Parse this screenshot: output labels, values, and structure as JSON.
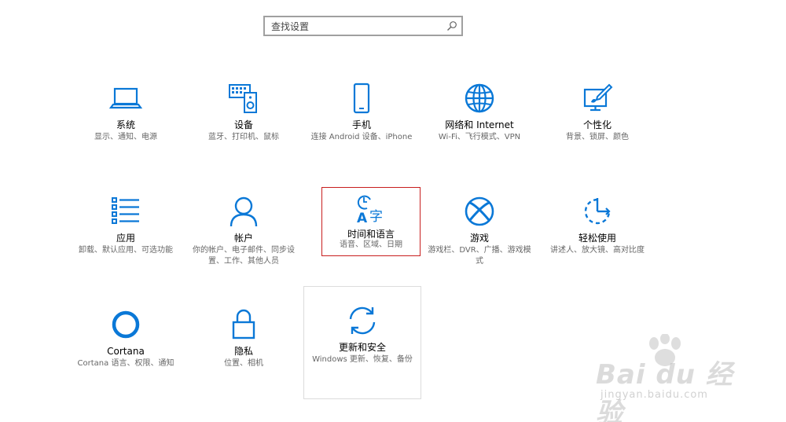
{
  "search": {
    "placeholder": "查找设置"
  },
  "tiles": [
    {
      "title": "系统",
      "desc": "显示、通知、电源"
    },
    {
      "title": "设备",
      "desc": "蓝牙、打印机、鼠标"
    },
    {
      "title": "手机",
      "desc": "连接 Android 设备、iPhone"
    },
    {
      "title": "网络和 Internet",
      "desc": "Wi-Fi、飞行模式、VPN"
    },
    {
      "title": "个性化",
      "desc": "背景、锁屏、颜色"
    },
    {
      "title": "应用",
      "desc": "卸载、默认应用、可选功能"
    },
    {
      "title": "帐户",
      "desc": "你的帐户、电子邮件、同步设置、工作、其他人员"
    },
    {
      "title": "时间和语言",
      "desc": "语音、区域、日期"
    },
    {
      "title": "游戏",
      "desc": "游戏栏、DVR、广播、游戏模式"
    },
    {
      "title": "轻松使用",
      "desc": "讲述人、放大镜、高对比度"
    },
    {
      "title": "Cortana",
      "desc": "Cortana 语言、权限、通知"
    },
    {
      "title": "隐私",
      "desc": "位置、相机"
    },
    {
      "title": "更新和安全",
      "desc": "Windows 更新、恢复、备份"
    }
  ],
  "colors": {
    "accent": "#0a78d7",
    "highlight_border": "#c81e1e"
  },
  "watermark": {
    "main": "Bai du 经验",
    "sub": "jingyan.baidu.com"
  }
}
